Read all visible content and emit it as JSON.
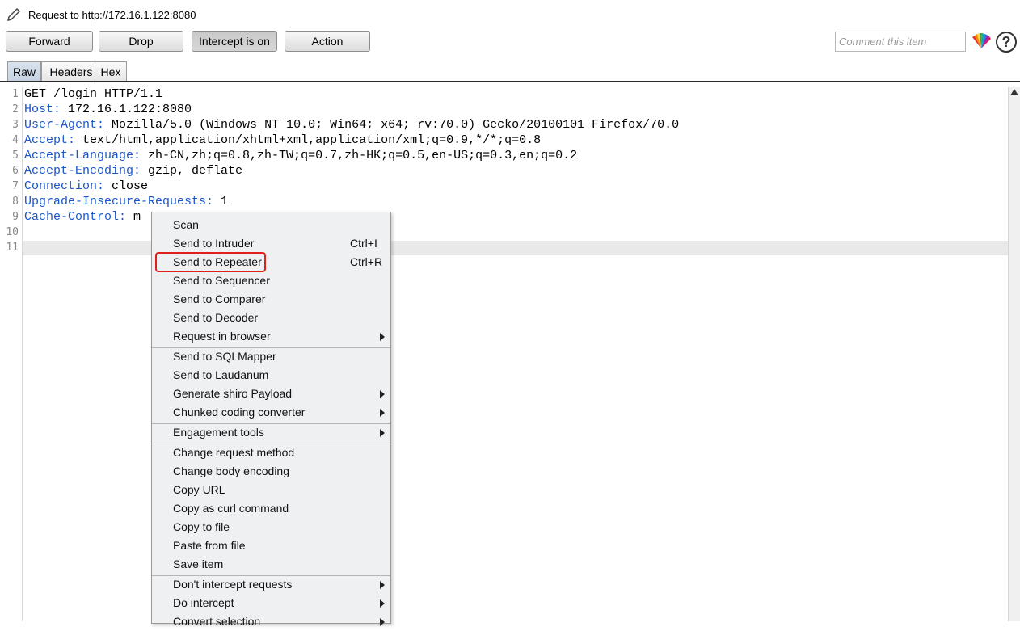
{
  "window": {
    "title": "Request to http://172.16.1.122:8080"
  },
  "toolbar": {
    "forward": "Forward",
    "drop": "Drop",
    "intercept": "Intercept is on",
    "action": "Action",
    "comment_placeholder": "Comment this item",
    "help": "?"
  },
  "tabs": [
    "Raw",
    "Headers",
    "Hex"
  ],
  "editor": {
    "line_numbers": [
      "1",
      "2",
      "3",
      "4",
      "5",
      "6",
      "7",
      "8",
      "9",
      "10",
      "11"
    ],
    "lines": [
      {
        "key": "",
        "value": "GET /login HTTP/1.1"
      },
      {
        "key": "Host:",
        "value": " 172.16.1.122:8080"
      },
      {
        "key": "User-Agent:",
        "value": " Mozilla/5.0 (Windows NT 10.0; Win64; x64; rv:70.0) Gecko/20100101 Firefox/70.0"
      },
      {
        "key": "Accept:",
        "value": " text/html,application/xhtml+xml,application/xml;q=0.9,*/*;q=0.8"
      },
      {
        "key": "Accept-Language:",
        "value": " zh-CN,zh;q=0.8,zh-TW;q=0.7,zh-HK;q=0.5,en-US;q=0.3,en;q=0.2"
      },
      {
        "key": "Accept-Encoding:",
        "value": " gzip, deflate"
      },
      {
        "key": "Connection:",
        "value": " close"
      },
      {
        "key": "Upgrade-Insecure-Requests:",
        "value": " 1"
      },
      {
        "key": "Cache-Control:",
        "value": " m"
      }
    ]
  },
  "context_menu": {
    "items": [
      {
        "label": "Scan"
      },
      {
        "label": "Send to Intruder",
        "shortcut": "Ctrl+I"
      },
      {
        "label": "Send to Repeater",
        "shortcut": "Ctrl+R"
      },
      {
        "label": "Send to Sequencer"
      },
      {
        "label": "Send to Comparer"
      },
      {
        "label": "Send to Decoder"
      },
      {
        "label": "Request in browser",
        "submenu": true
      },
      {
        "label": "Send to SQLMapper"
      },
      {
        "label": "Send to Laudanum"
      },
      {
        "label": "Generate shiro Payload",
        "submenu": true
      },
      {
        "label": "Chunked coding converter",
        "submenu": true
      },
      {
        "label": "Engagement tools",
        "submenu": true
      },
      {
        "label": "Change request method"
      },
      {
        "label": "Change body encoding"
      },
      {
        "label": "Copy URL"
      },
      {
        "label": "Copy as curl command"
      },
      {
        "label": "Copy to file"
      },
      {
        "label": "Paste from file"
      },
      {
        "label": "Save item"
      },
      {
        "label": "Don't intercept requests",
        "submenu": true
      },
      {
        "label": "Do intercept",
        "submenu": true
      },
      {
        "label": "Convert selection",
        "submenu": true
      }
    ]
  },
  "colors": {
    "header_key": "#1b56c9",
    "highlight_box": "#e0201a"
  }
}
